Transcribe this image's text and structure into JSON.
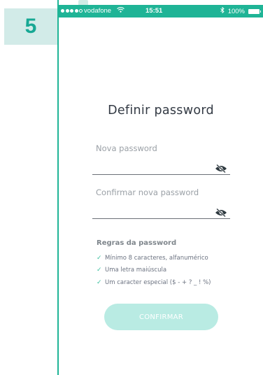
{
  "step": {
    "number": "5"
  },
  "status_bar": {
    "carrier": "vodafone",
    "time": "15:51",
    "battery": "100%",
    "signal_icon": "signal-dots-icon",
    "wifi_icon": "wifi-icon",
    "bluetooth_icon": "bluetooth-icon",
    "battery_icon": "battery-icon"
  },
  "form": {
    "title": "Definir  password",
    "fields": [
      {
        "label": "Nova password",
        "value": "",
        "visibility_icon": "eye-slash-icon"
      },
      {
        "label": "Confirmar nova password",
        "value": "",
        "visibility_icon": "eye-slash-icon"
      }
    ]
  },
  "rules": {
    "title": "Regras da password",
    "items": [
      "Mínimo 8 caracteres, alfanumérico",
      "Uma letra maiúscula",
      "Um caracter especial ($ - + ? _ ! %)"
    ],
    "check_icon": "check-icon"
  },
  "confirm_button": {
    "label": "CONFIRMAR",
    "enabled": false
  },
  "colors": {
    "accent": "#1fb496",
    "badge_bg": "#d2ebe8",
    "badge_text": "#17a894",
    "button_disabled": "#b9ebe3",
    "check": "#3bbf9e"
  }
}
